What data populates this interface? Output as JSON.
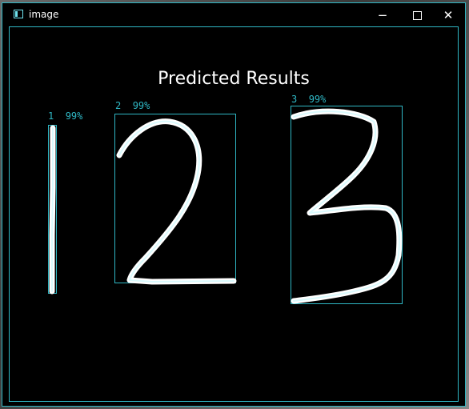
{
  "window": {
    "title": "image",
    "controls": {
      "minimize": "−",
      "close": "✕"
    },
    "accent_color": "#2fb7c4"
  },
  "canvas": {
    "heading": "Predicted Results",
    "predictions": [
      {
        "digit": "1",
        "confidence": "99%"
      },
      {
        "digit": "2",
        "confidence": "99%"
      },
      {
        "digit": "3",
        "confidence": "99%"
      }
    ]
  }
}
